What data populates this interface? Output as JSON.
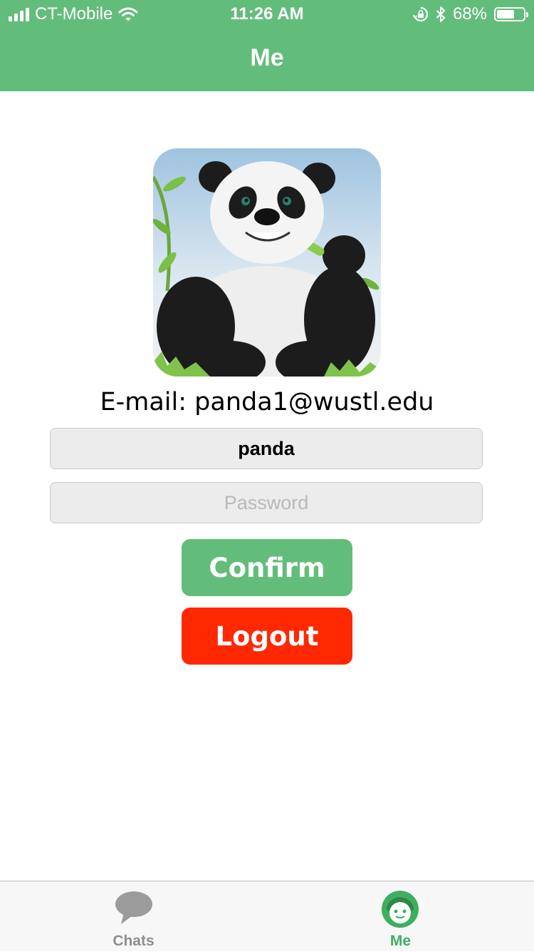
{
  "status_bar": {
    "carrier": "CT-Mobile",
    "time": "11:26 AM",
    "battery": "68%",
    "battery_level": 0.68,
    "icons": [
      "signal-icon",
      "wifi-icon",
      "rotation-lock-icon",
      "bluetooth-icon",
      "battery-icon"
    ]
  },
  "header": {
    "title": "Me"
  },
  "profile": {
    "avatar": "panda-avatar",
    "email": "E-mail: panda1@wustl.edu"
  },
  "form": {
    "username_value": "panda",
    "password_value": "",
    "password_placeholder": "Password",
    "confirm_label": "Confirm",
    "logout_label": "Logout"
  },
  "tabbar": {
    "tabs": [
      {
        "label": "Chats",
        "icon": "chat-bubble-icon",
        "active": false
      },
      {
        "label": "Me",
        "icon": "face-icon",
        "active": true
      }
    ]
  },
  "colors": {
    "accent": "#63bd7a",
    "danger": "#ff2800",
    "tab_active": "#3fae5f",
    "tab_inactive": "#8e8e8e"
  }
}
